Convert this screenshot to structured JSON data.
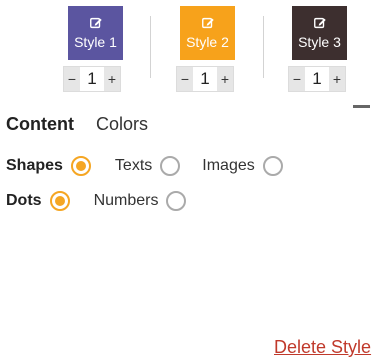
{
  "styles": [
    {
      "label": "Style 1",
      "color": "#5b55a0",
      "quantity": "1",
      "minus": "−",
      "plus": "+"
    },
    {
      "label": "Style 2",
      "color": "#f7a21b",
      "quantity": "1",
      "minus": "−",
      "plus": "+"
    },
    {
      "label": "Style 3",
      "color": "#3d2f2f",
      "quantity": "1",
      "minus": "−",
      "plus": "+"
    }
  ],
  "tabs": {
    "active": "Content",
    "inactive": "Colors"
  },
  "row1": {
    "title": "Shapes",
    "opt1": "Texts",
    "opt2": "Images"
  },
  "row2": {
    "title": "Dots",
    "opt1": "Numbers"
  },
  "delete_label": "Delete Style",
  "accent": "#f5a623",
  "icons": {
    "edit": "edit-icon",
    "collapse": "minus-icon"
  }
}
